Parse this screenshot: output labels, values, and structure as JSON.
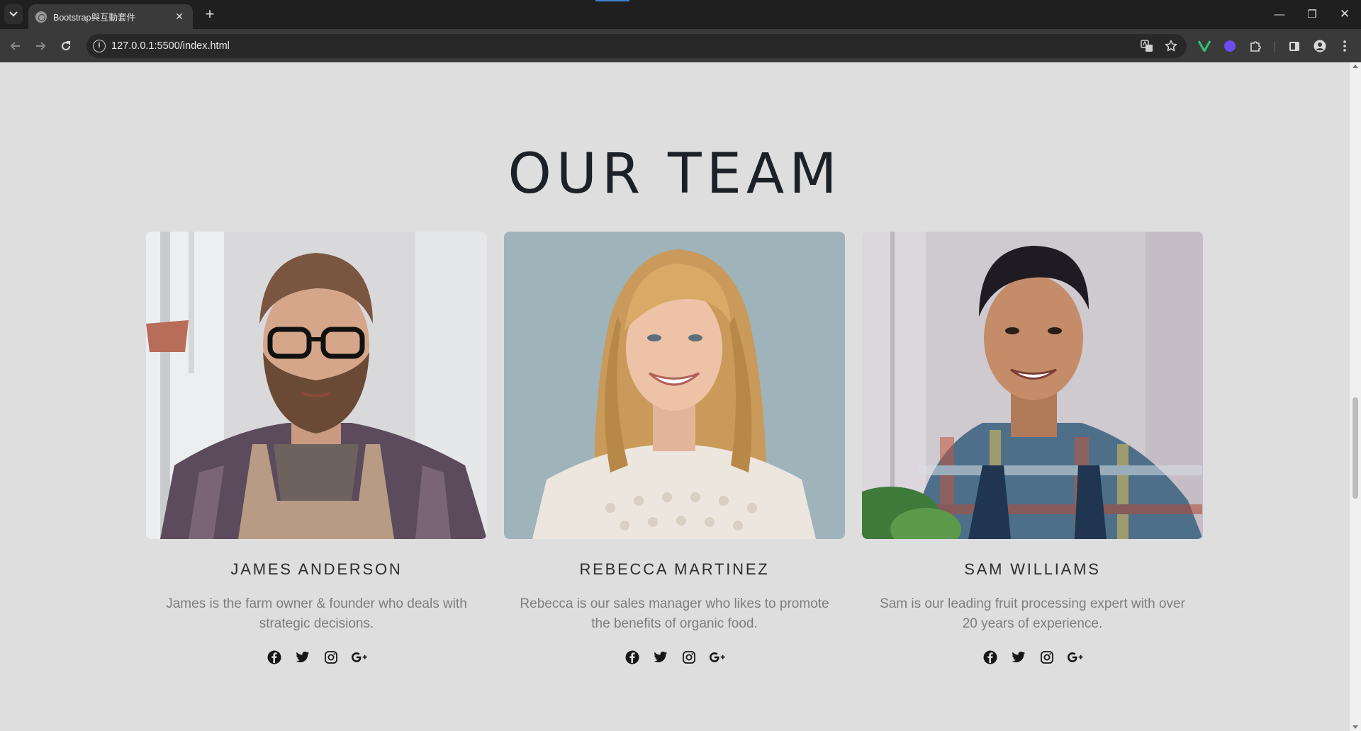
{
  "browser": {
    "tab_title": "Bootstrap與互動套件",
    "tab_close": "✕",
    "new_tab": "+",
    "url": "127.0.0.1:5500/index.html",
    "window_controls": {
      "minimize": "—",
      "restore": "❐",
      "close": "✕"
    }
  },
  "section": {
    "title": "OUR TEAM"
  },
  "team": [
    {
      "name": "JAMES ANDERSON",
      "description": "James is the farm owner & founder who deals with strategic decisions.",
      "social_icons": [
        "facebook-icon",
        "twitter-icon",
        "instagram-icon",
        "google-plus-icon"
      ]
    },
    {
      "name": "REBECCA MARTINEZ",
      "description": "Rebecca is our sales manager who likes to promote the benefits of organic food.",
      "social_icons": [
        "facebook-icon",
        "twitter-icon",
        "instagram-icon",
        "google-plus-icon"
      ]
    },
    {
      "name": "SAM WILLIAMS",
      "description": "Sam is our leading fruit processing expert with over 20 years of experience.",
      "social_icons": [
        "facebook-icon",
        "twitter-icon",
        "instagram-icon",
        "google-plus-icon"
      ]
    }
  ],
  "colors": {
    "page_background": "#dedede",
    "title": "#1c2127",
    "name": "#2d2d2d",
    "description": "#7d7d7d"
  }
}
